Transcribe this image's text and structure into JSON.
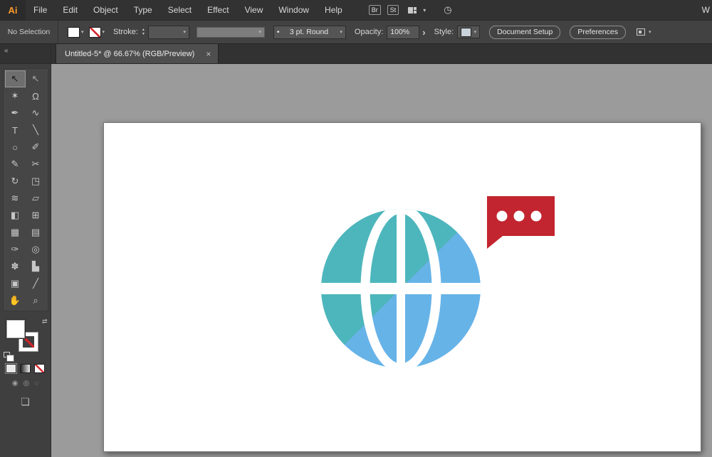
{
  "app": {
    "logo": "Ai",
    "window_hint": "W"
  },
  "icons": {
    "chevron": "▾",
    "stepper_up": "▴",
    "stepper_down": "▾",
    "panel_arrow": "›",
    "gauge": "◷",
    "collapse": "«",
    "swap": "⇄",
    "screen_mode": "❏",
    "draw_normal": "◉",
    "draw_behind": "◎",
    "draw_inside": "◌",
    "close": "×",
    "bullet": "•"
  },
  "menubar": {
    "items": [
      "File",
      "Edit",
      "Object",
      "Type",
      "Select",
      "Effect",
      "View",
      "Window",
      "Help"
    ],
    "bridge": "Br",
    "stock": "St"
  },
  "control_bar": {
    "selection_status": "No Selection",
    "stroke_label": "Stroke:",
    "brush_value": "3 pt. Round",
    "opacity_label": "Opacity:",
    "opacity_value": "100%",
    "style_label": "Style:",
    "document_setup_label": "Document Setup",
    "preferences_label": "Preferences"
  },
  "tabbar": {
    "title": "Untitled-5* @ 66.67% (RGB/Preview)"
  },
  "toolbar": {
    "tools": [
      {
        "name": "selection",
        "glyph": "↖"
      },
      {
        "name": "direct-selection",
        "glyph": "↖"
      },
      {
        "name": "magic-wand",
        "glyph": "✶"
      },
      {
        "name": "lasso",
        "glyph": "Ω"
      },
      {
        "name": "pen",
        "glyph": "✒"
      },
      {
        "name": "curvature",
        "glyph": "∿"
      },
      {
        "name": "type",
        "glyph": "T"
      },
      {
        "name": "line-segment",
        "glyph": "╲"
      },
      {
        "name": "ellipse",
        "glyph": "○"
      },
      {
        "name": "paintbrush",
        "glyph": "✐"
      },
      {
        "name": "shaper",
        "glyph": "✎"
      },
      {
        "name": "scissors",
        "glyph": "✂"
      },
      {
        "name": "rotate",
        "glyph": "↻"
      },
      {
        "name": "scale",
        "glyph": "◳"
      },
      {
        "name": "width",
        "glyph": "≋"
      },
      {
        "name": "free-transform",
        "glyph": "▱"
      },
      {
        "name": "shape-builder",
        "glyph": "◧"
      },
      {
        "name": "perspective-grid",
        "glyph": "⊞"
      },
      {
        "name": "mesh",
        "glyph": "▦"
      },
      {
        "name": "gradient",
        "glyph": "▤"
      },
      {
        "name": "eyedropper",
        "glyph": "✑"
      },
      {
        "name": "blend",
        "glyph": "◎"
      },
      {
        "name": "symbol-sprayer",
        "glyph": "✽"
      },
      {
        "name": "column-graph",
        "glyph": "▙"
      },
      {
        "name": "artboard",
        "glyph": "▣"
      },
      {
        "name": "slice",
        "glyph": "╱"
      },
      {
        "name": "hand",
        "glyph": "✋"
      },
      {
        "name": "zoom",
        "glyph": "⌕"
      }
    ]
  },
  "artwork": {
    "colors": {
      "teal": "#4DB6BC",
      "blue": "#66B3E8",
      "red": "#C2252F",
      "white": "#FFFFFF"
    }
  }
}
